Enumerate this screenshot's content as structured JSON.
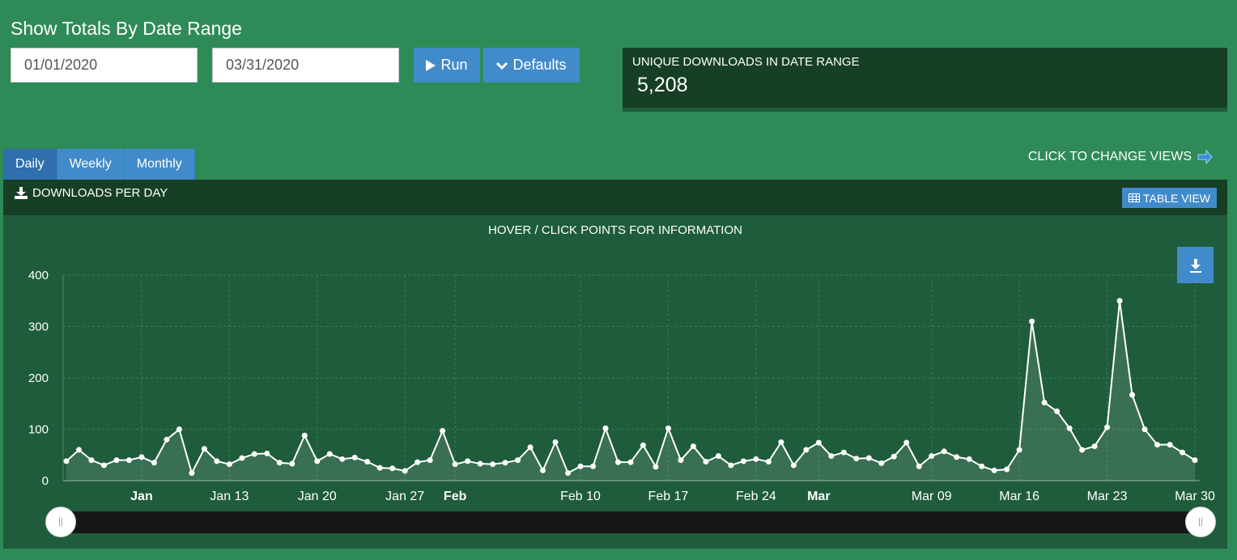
{
  "header": {
    "title": "Show Totals By Date Range",
    "start_date": "01/01/2020",
    "end_date": "03/31/2020",
    "run_label": "Run",
    "defaults_label": "Defaults"
  },
  "stat": {
    "label": "UNIQUE DOWNLOADS IN DATE RANGE",
    "value": "5,208"
  },
  "tabs": [
    {
      "label": "Daily",
      "active": true
    },
    {
      "label": "Weekly",
      "active": false
    },
    {
      "label": "Monthly",
      "active": false
    }
  ],
  "change_views_label": "CLICK TO CHANGE VIEWS",
  "panel": {
    "title": "DOWNLOADS PER DAY",
    "table_view_label": "TABLE VIEW",
    "hint": "HOVER / CLICK POINTS FOR INFORMATION"
  },
  "colors": {
    "background": "#2e8b57",
    "panel": "#1e5c3c",
    "dark": "#163f26",
    "accent": "#428bca"
  },
  "icons": {
    "run": "play-icon",
    "defaults": "chevron-down-icon",
    "download": "download-icon",
    "table": "table-icon",
    "export": "export-download-icon"
  },
  "chart_data": {
    "type": "area",
    "title": "",
    "xlabel": "",
    "ylabel": "",
    "ylim": [
      0,
      400
    ],
    "yticks": [
      0,
      100,
      200,
      300,
      400
    ],
    "grid": true,
    "x_start": "2020-01-01",
    "xticks": [
      {
        "label": "Jan",
        "day": 6,
        "bold": true
      },
      {
        "label": "Jan 13",
        "day": 13,
        "bold": false
      },
      {
        "label": "Jan 20",
        "day": 20,
        "bold": false
      },
      {
        "label": "Jan 27",
        "day": 27,
        "bold": false
      },
      {
        "label": "Feb",
        "day": 31,
        "bold": true
      },
      {
        "label": "Feb 10",
        "day": 41,
        "bold": false
      },
      {
        "label": "Feb 17",
        "day": 48,
        "bold": false
      },
      {
        "label": "Feb 24",
        "day": 55,
        "bold": false
      },
      {
        "label": "Mar",
        "day": 60,
        "bold": true
      },
      {
        "label": "Mar 09",
        "day": 69,
        "bold": false
      },
      {
        "label": "Mar 16",
        "day": 76,
        "bold": false
      },
      {
        "label": "Mar 23",
        "day": 83,
        "bold": false
      },
      {
        "label": "Mar 30",
        "day": 90,
        "bold": false
      }
    ],
    "series": [
      {
        "name": "",
        "values": [
          38,
          60,
          40,
          30,
          40,
          40,
          46,
          35,
          80,
          100,
          15,
          62,
          38,
          32,
          44,
          52,
          53,
          35,
          33,
          88,
          38,
          52,
          42,
          45,
          37,
          25,
          24,
          19,
          36,
          40,
          97,
          32,
          38,
          33,
          32,
          35,
          40,
          65,
          20,
          75,
          15,
          28,
          28,
          102,
          36,
          36,
          69,
          27,
          102,
          40,
          67,
          37,
          48,
          30,
          38,
          42,
          37,
          75,
          30,
          60,
          74,
          48,
          55,
          43,
          44,
          34,
          47,
          74,
          28,
          48,
          57,
          46,
          42,
          28,
          20,
          22,
          60,
          310,
          152,
          135,
          102,
          60,
          67,
          104,
          350,
          167,
          100,
          70,
          70,
          55,
          40
        ]
      }
    ]
  }
}
